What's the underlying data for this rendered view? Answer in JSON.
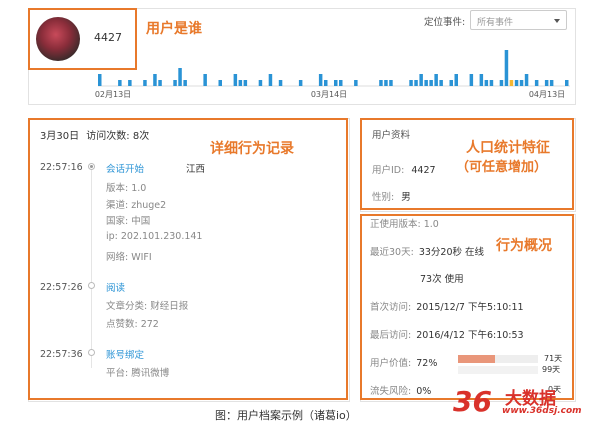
{
  "header": {
    "user_id": "4427",
    "filter_label": "定位事件:",
    "filter_value": "所有事件",
    "annotation": "用户是谁"
  },
  "chart_data": {
    "type": "bar",
    "x_tick_labels": [
      "02月13日",
      "03月14日",
      "04月13日"
    ],
    "values": [
      2,
      0,
      0,
      0,
      1,
      0,
      1,
      0,
      0,
      1,
      0,
      2,
      1,
      0,
      0,
      1,
      3,
      1,
      0,
      0,
      0,
      2,
      0,
      0,
      1,
      0,
      0,
      2,
      1,
      1,
      0,
      0,
      1,
      0,
      2,
      0,
      1,
      0,
      0,
      0,
      1,
      0,
      0,
      0,
      2,
      1,
      0,
      1,
      1,
      0,
      0,
      1,
      0,
      0,
      0,
      0,
      1,
      1,
      1,
      0,
      0,
      0,
      1,
      1,
      2,
      1,
      1,
      2,
      1,
      0,
      1,
      2,
      0,
      0,
      2,
      0,
      2,
      1,
      1,
      0,
      1,
      6,
      1,
      1,
      1,
      2,
      0,
      1,
      0,
      1,
      1,
      0,
      0,
      1
    ],
    "highlight_index": 82,
    "colors": {
      "bar": "#2a93d5",
      "highlight": "#f5b731"
    }
  },
  "detail": {
    "date_label": "3月30日",
    "visits_label": "访问次数: 8次",
    "annotation": "详细行为记录",
    "events": [
      {
        "time": "22:57:16",
        "title": "会话开始",
        "extra": "江西",
        "props": [
          "版本: 1.0",
          "渠道: zhuge2",
          "国家: 中国",
          "ip: 202.101.230.141",
          "网络: WIFI"
        ]
      },
      {
        "time": "22:57:26",
        "title": "阅读",
        "extra": "",
        "props": [
          "文章分类: 财经日报",
          "点赞数: 272"
        ]
      },
      {
        "time": "22:57:36",
        "title": "账号绑定",
        "extra": "",
        "props": [
          "平台: 腾讯微博"
        ]
      }
    ]
  },
  "profile": {
    "title": "用户资料",
    "user_id_label": "用户ID:",
    "user_id_value": "4427",
    "gender_label": "性别:",
    "gender_value": "男",
    "annotation_line1": "人口统计特征",
    "annotation_line2": "（可任意增加）"
  },
  "behavior": {
    "annotation": "行为概况",
    "version_line": "正使用版本: 1.0",
    "last30_label": "最近30天:",
    "online_value": "33分20秒 在线",
    "usage_value": "73次 使用",
    "first_visit_label": "首次访问:",
    "first_visit_value": "2015/12/7 下午5:10:11",
    "last_visit_label": "最后访问:",
    "last_visit_value": "2016/4/12 下午6:10:53",
    "value_label": "用户价值:",
    "value_pct": "72%",
    "value_fraction": 0.72,
    "bar1_days": "71天",
    "bar2_days": "99天",
    "churn_label": "流失风险:",
    "churn_pct": "0%",
    "churn_days": "0天"
  },
  "caption": "图：用户档案示例（诸葛io）",
  "watermark": {
    "brand": "36",
    "name": "大数据",
    "url": "www.36dsj.com"
  }
}
